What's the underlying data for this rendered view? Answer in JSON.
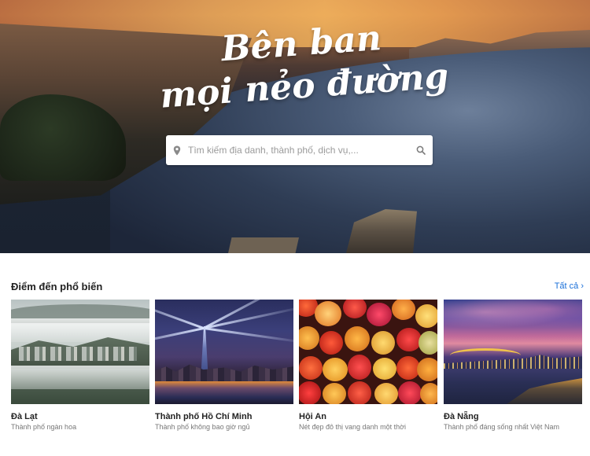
{
  "hero": {
    "title_line1": "Bên ban",
    "title_line2": "mọi nẻo đường",
    "search": {
      "placeholder": "Tìm kiếm địa danh, thành phố, dịch vụ,...",
      "pin_icon": "map-pin-icon",
      "search_icon": "search-icon"
    }
  },
  "popular": {
    "title": "Điểm đến phổ biến",
    "see_all": "Tất cả ›",
    "link_color": "#1a6fd8",
    "cards": [
      {
        "name": "Đà Lạt",
        "subtitle": "Thành phố ngàn hoa"
      },
      {
        "name": "Thành phố Hồ Chí Minh",
        "subtitle": "Thành phố không bao giờ ngủ"
      },
      {
        "name": "Hội An",
        "subtitle": "Nét đẹp đô thị vang danh một thời"
      },
      {
        "name": "Đà Nẵng",
        "subtitle": "Thành phố đáng sống nhất Việt Nam"
      }
    ]
  }
}
